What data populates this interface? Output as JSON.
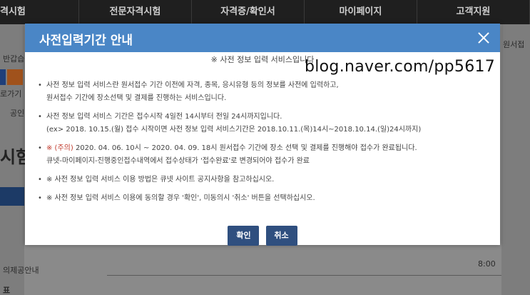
{
  "background": {
    "nav": [
      "격시험",
      "전문자격시험",
      "자격증/확인서",
      "마이페이지",
      "고객지원"
    ],
    "left_texts": [
      "반갑습",
      "로가기",
      "공인",
      "시험"
    ],
    "left_bottom": [
      "의제공안내",
      "표"
    ],
    "right_texts": [
      "원서접"
    ],
    "table_values": [
      "8:00"
    ]
  },
  "modal": {
    "title": "사전입력기간 안내",
    "subtitle": "※ 사전 정보 입력 서비스입니다",
    "watermark": "blog.naver.com/pp5617",
    "items": [
      {
        "lines": [
          "사전 정보 입력 서비스란 원서접수 기간 이전에 자격, 종목, 응시유형 등의 정보를 사전에 입력하고,",
          "원서접수 기간에 장소선택 및 결제를 진행하는 서비스입니다."
        ]
      },
      {
        "lines": [
          "사전 정보 입력 서비스 기간은 접수시작 4일전 14시부터 전일 24시까지입니다.",
          "(ex> 2018. 10.15.(월) 접수 시작이면 사전 정보 입력 서비스기간은 2018.10.11.(목)14시~2018.10.14.(일)24시까지)"
        ]
      },
      {
        "warn": "※ (주의)",
        "lines": [
          " 2020. 04. 06. 10시 ~ 2020. 04. 09. 18시 원서접수 기간에 장소 선택 및 결제를 진행해야 접수가 완료됩니다.",
          "큐넷-마이페이지-진행중인접수내역에서 접수상태가 '접수완료'로 변경되어야 접수가 완료"
        ]
      },
      {
        "lines": [
          "※ 사전 정보 입력 서비스 이용 방법은 큐넷 사이트 공지사항을 참고하십시오."
        ]
      },
      {
        "lines": [
          "※ 사전 정보 입력 서비스 이용에 동의할 경우 '확인', 미동의시 '취소' 버튼을 선택하십시오."
        ]
      }
    ],
    "bullet": "•",
    "confirm_label": "확인",
    "cancel_label": "취소"
  }
}
